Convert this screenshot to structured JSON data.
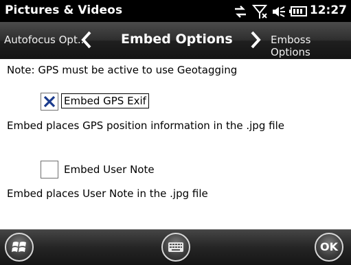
{
  "titlebar": {
    "app_title": "Pictures & Videos",
    "clock": "12:27",
    "icons": [
      "data-transfer-icon",
      "no-signal-icon",
      "speaker-icon",
      "battery-icon"
    ]
  },
  "nav": {
    "prev_label": "Autofocus Opt...",
    "current": "Embed Options",
    "next_label": "Emboss Options"
  },
  "content": {
    "note": "Note: GPS must be active to use Geotagging",
    "options": [
      {
        "label": "Embed GPS Exif",
        "checked": true,
        "description": "Embed places GPS position information in the .jpg file"
      },
      {
        "label": "Embed User Note",
        "checked": false,
        "description": "Embed places User Note in the .jpg file"
      }
    ]
  },
  "softkeys": {
    "ok_label": "OK",
    "icons": [
      "windows-start-icon",
      "keyboard-icon"
    ]
  },
  "colors": {
    "titlebar_bg": "#000000",
    "content_bg": "#ffffff",
    "text": "#000000"
  }
}
